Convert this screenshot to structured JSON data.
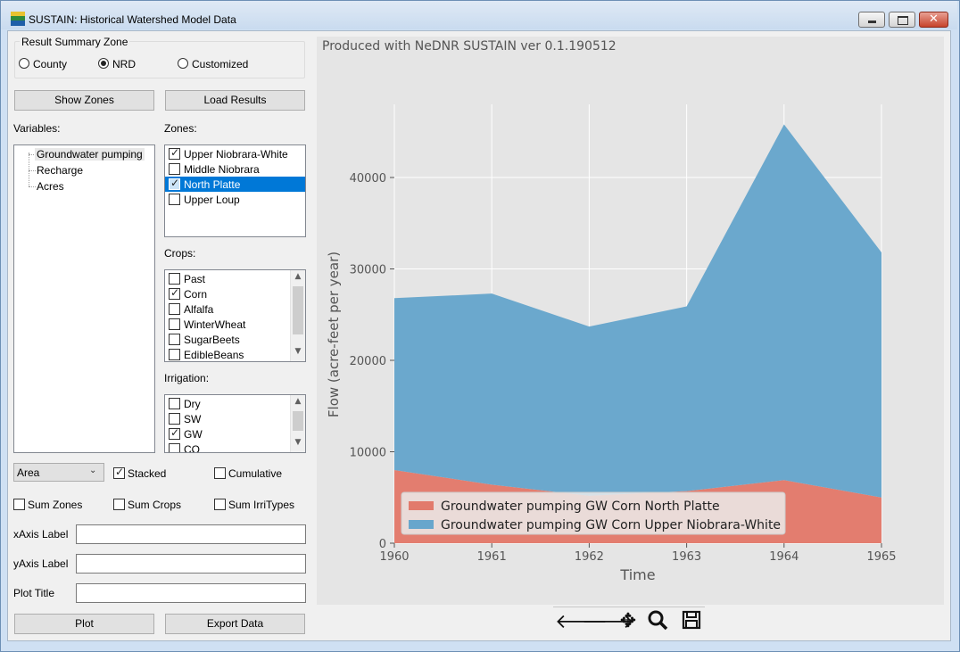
{
  "window": {
    "title": "SUSTAIN: Historical Watershed Model Data"
  },
  "summary_zone": {
    "label": "Result Summary Zone",
    "options": [
      "County",
      "NRD",
      "Customized"
    ],
    "selected": "NRD"
  },
  "buttons": {
    "show_zones": "Show Zones",
    "load_results": "Load Results",
    "plot": "Plot",
    "export_data": "Export Data"
  },
  "variables": {
    "label": "Variables:",
    "items": [
      "Groundwater pumping",
      "Recharge",
      "Acres"
    ],
    "selected": "Groundwater pumping"
  },
  "zones": {
    "label": "Zones:",
    "items": [
      {
        "label": "Upper Niobrara-White",
        "checked": true
      },
      {
        "label": "Middle Niobrara",
        "checked": false
      },
      {
        "label": "North Platte",
        "checked": true
      },
      {
        "label": "Upper Loup",
        "checked": false
      }
    ],
    "selected": "North Platte"
  },
  "crops": {
    "label": "Crops:",
    "items": [
      {
        "label": "Past",
        "checked": false
      },
      {
        "label": "Corn",
        "checked": true
      },
      {
        "label": "Alfalfa",
        "checked": false
      },
      {
        "label": "WinterWheat",
        "checked": false
      },
      {
        "label": "SugarBeets",
        "checked": false
      },
      {
        "label": "EdibleBeans",
        "checked": false
      }
    ]
  },
  "irrigation": {
    "label": "Irrigation:",
    "items": [
      {
        "label": "Dry",
        "checked": false
      },
      {
        "label": "SW",
        "checked": false
      },
      {
        "label": "GW",
        "checked": true
      },
      {
        "label": "CO",
        "checked": false
      }
    ]
  },
  "options": {
    "plot_type": "Area",
    "stacked_label": "Stacked",
    "stacked": true,
    "cumulative_label": "Cumulative",
    "cumulative": false,
    "sum_zones_label": "Sum Zones",
    "sum_zones": false,
    "sum_crops_label": "Sum Crops",
    "sum_crops": false,
    "sum_irri_label": "Sum IrriTypes",
    "sum_irri": false
  },
  "fields": {
    "xaxis_label": "xAxis Label",
    "xaxis_value": "",
    "yaxis_label": "yAxis Label",
    "yaxis_value": "",
    "plot_title_label": "Plot Title",
    "plot_title_value": ""
  },
  "plot_caption": "Produced with NeDNR SUSTAIN ver 0.1.190512",
  "colors": {
    "series_north_platte": "#e27a6c",
    "series_upper_niobrara": "#68a6cc",
    "axes_bg": "#e5e5e5",
    "grid": "#ffffff",
    "selection": "#0078d7"
  },
  "chart_data": {
    "type": "area",
    "stacked": true,
    "x": [
      1960,
      1961,
      1962,
      1963,
      1964,
      1965
    ],
    "xlabel": "Time",
    "ylabel": "Flow (acre-feet per year)",
    "xlim": [
      1960,
      1965
    ],
    "ylim": [
      0,
      48000
    ],
    "yticks": [
      0,
      10000,
      20000,
      30000,
      40000
    ],
    "grid": true,
    "legend": "lower-left",
    "series": [
      {
        "name": "Groundwater pumping GW Corn North Platte",
        "values": [
          8000,
          6400,
          5200,
          5700,
          6900,
          5000
        ]
      },
      {
        "name": "Groundwater pumping GW Corn Upper Niobrara-White",
        "values": [
          18800,
          20900,
          18500,
          20200,
          38900,
          26800
        ]
      }
    ]
  },
  "toolbar": {
    "back_icon": "back-arrow-icon",
    "forward_icon": "forward-arrow-icon",
    "pan_icon": "pan-icon",
    "zoom_icon": "zoom-icon",
    "save_icon": "save-icon"
  }
}
